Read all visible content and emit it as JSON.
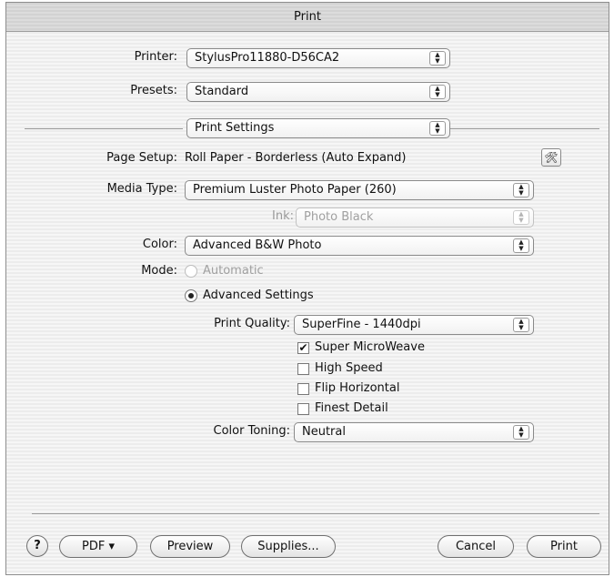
{
  "window": {
    "title": "Print"
  },
  "printer": {
    "label": "Printer:",
    "value": "StylusPro11880-D56CA2"
  },
  "presets": {
    "label": "Presets:",
    "value": "Standard"
  },
  "panel": {
    "value": "Print Settings"
  },
  "page_setup": {
    "label": "Page Setup:",
    "value": "Roll Paper - Borderless (Auto Expand)"
  },
  "media_type": {
    "label": "Media Type:",
    "value": "Premium Luster Photo Paper (260)"
  },
  "ink": {
    "label": "Ink:",
    "value": "Photo Black",
    "enabled": false
  },
  "color": {
    "label": "Color:",
    "value": "Advanced B&W Photo"
  },
  "mode": {
    "label": "Mode:",
    "options": [
      {
        "label": "Automatic",
        "selected": false,
        "enabled": false
      },
      {
        "label": "Advanced Settings",
        "selected": true,
        "enabled": true
      }
    ]
  },
  "print_quality": {
    "label": "Print Quality:",
    "value": "SuperFine - 1440dpi"
  },
  "checkboxes": [
    {
      "label": "Super MicroWeave",
      "checked": true
    },
    {
      "label": "High Speed",
      "checked": false
    },
    {
      "label": "Flip Horizontal",
      "checked": false
    },
    {
      "label": "Finest Detail",
      "checked": false
    }
  ],
  "color_toning": {
    "label": "Color Toning:",
    "value": "Neutral"
  },
  "footer": {
    "help_label": "?",
    "pdf_label": "PDF ▾",
    "preview_label": "Preview",
    "supplies_label": "Supplies...",
    "cancel_label": "Cancel",
    "print_label": "Print"
  },
  "icons": {
    "popup_arrows": "up-down-arrows-icon",
    "utility": "printer-utility-icon",
    "check": "checkmark-icon"
  }
}
